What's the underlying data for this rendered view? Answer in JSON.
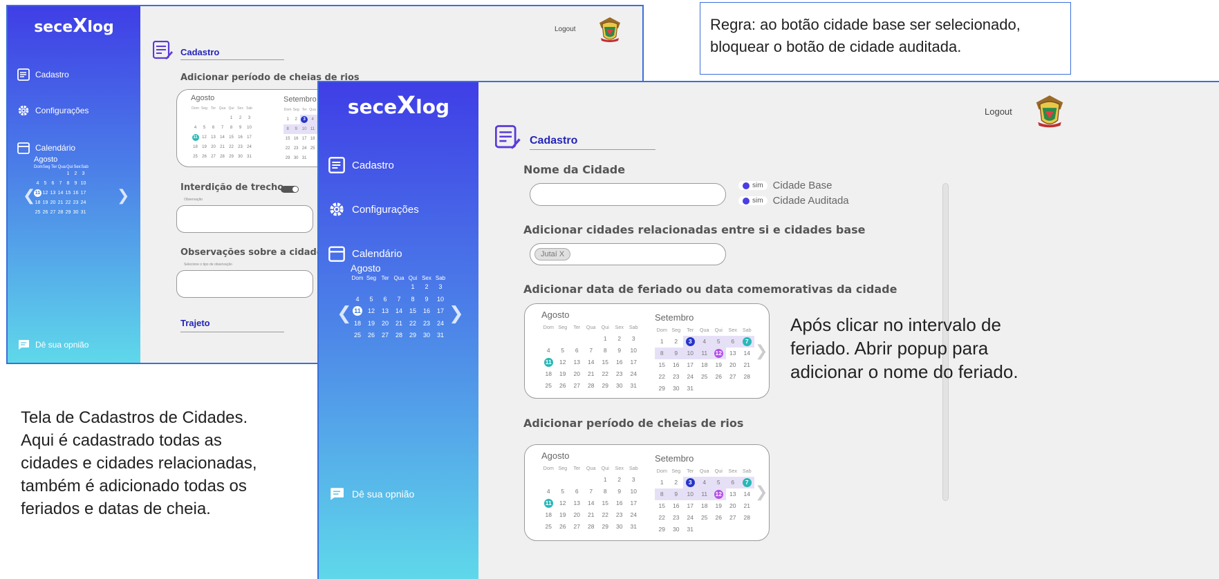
{
  "app": {
    "logo_left": "sece",
    "logo_x": "X",
    "logo_right": "log"
  },
  "sidebar": {
    "cadastro": "Cadastro",
    "config": "Configurações",
    "calendario": "Calendário",
    "month": "Agosto",
    "weekdays": [
      "Dom",
      "Seg",
      "Ter",
      "Qua",
      "Qui",
      "Sex",
      "Sab"
    ],
    "rows": [
      [
        "",
        "",
        "",
        "",
        "",
        "1",
        "2",
        "3"
      ],
      [
        "",
        "4",
        "5",
        "6",
        "7",
        "8",
        "9",
        "10"
      ],
      [
        "",
        "11",
        "12",
        "13",
        "14",
        "15",
        "16",
        "17"
      ],
      [
        "",
        "18",
        "19",
        "20",
        "21",
        "22",
        "23",
        "24"
      ],
      [
        "",
        "25",
        "26",
        "27",
        "28",
        "29",
        "30",
        "31"
      ]
    ],
    "feedback": "Dê sua opnião"
  },
  "header": {
    "logout": "Logout"
  },
  "back": {
    "title": "Cadastro",
    "periodo": "Adicionar período de cheias de rios",
    "month1": "Agosto",
    "month2": "Setembro",
    "interdicao": "Interdição de trecho",
    "obs_small": "Observação",
    "observacoes": "Observações sobre a cidade",
    "obs_hint": "Selecione o tipo de observação",
    "trajeto": "Trajeto"
  },
  "front": {
    "title": "Cadastro",
    "nome": "Nome da Cidade",
    "radio_pill": "sim",
    "cidade_base": "Cidade Base",
    "cidade_auditada": "Cidade Auditada",
    "relacionadas": "Adicionar cidades relacionadas entre si e cidades base",
    "chip": "Jutaí  X",
    "feriado": "Adicionar data de feriado ou data comemorativas da cidade",
    "cheias": "Adicionar período de cheias de rios",
    "month1": "Agosto",
    "month2": "Setembro"
  },
  "notes": {
    "rule": "Regra: ao botão cidade base ser selecionado, bloquear o botão de cidade auditada.",
    "popup_1": "Após clicar no intervalo de",
    "popup_2": "feriado. Abrir popup para",
    "popup_3": "adicionar o nome do feriado.",
    "desc_1": "Tela de Cadastros de Cidades.",
    "desc_2": "Aqui é cadastrado todas as",
    "desc_3": "cidades e cidades relacionadas,",
    "desc_4": "também é adicionado todas os",
    "desc_5": "feriados e datas de cheia."
  },
  "calendar": {
    "aug_rows": [
      [
        "",
        "",
        "",
        "",
        "1",
        "2",
        "3"
      ],
      [
        "4",
        "5",
        "6",
        "7",
        "8",
        "9",
        "10"
      ],
      [
        "11",
        "12",
        "13",
        "14",
        "15",
        "16",
        "17"
      ],
      [
        "18",
        "19",
        "20",
        "21",
        "22",
        "23",
        "24"
      ],
      [
        "25",
        "26",
        "27",
        "28",
        "29",
        "30",
        "31"
      ]
    ],
    "sep_rows": [
      [
        "1",
        "2",
        "3",
        "4",
        "5",
        "6",
        "7"
      ],
      [
        "8",
        "9",
        "10",
        "11",
        "12",
        "13",
        "14"
      ],
      [
        "15",
        "16",
        "17",
        "18",
        "19",
        "20",
        "21"
      ],
      [
        "22",
        "23",
        "24",
        "25",
        "26",
        "27",
        "28"
      ],
      [
        "29",
        "30",
        "31",
        "",
        "",
        "",
        ""
      ]
    ]
  },
  "colors": {
    "accent": "#2424b8",
    "teal": "#2ab7b7",
    "blue": "#2535c9",
    "purple": "#b44fe6",
    "frame": "#3a6fd8"
  }
}
